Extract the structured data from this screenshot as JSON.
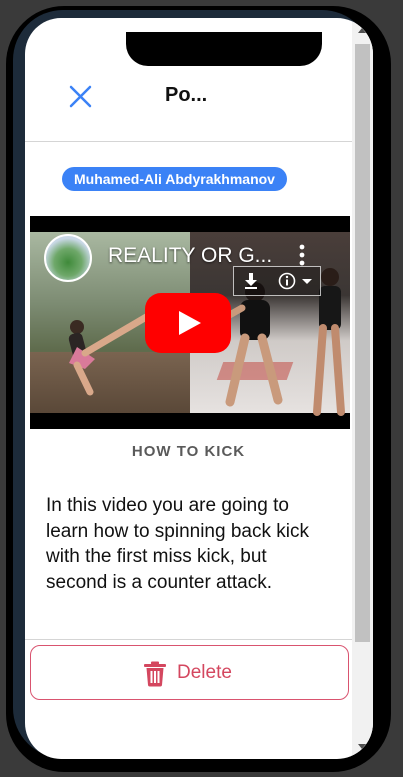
{
  "header": {
    "title": "Po...",
    "close_icon": "close-icon"
  },
  "post": {
    "author": "Muhamed-Ali Abdyrakhmanov",
    "title": "HOW TO KICK",
    "body": "In this video you are going to learn how to spinning back kick with the first miss kick, but second is a counter attack."
  },
  "video": {
    "title": "REALITY OR G...",
    "icons": [
      "more-vertical-icon",
      "download-icon",
      "info-icon",
      "play-icon"
    ]
  },
  "actions": {
    "delete_label": "Delete",
    "delete_icon": "trash-icon"
  },
  "colors": {
    "accent": "#3b82f6",
    "danger": "#d4475f",
    "play": "#ff0000"
  }
}
